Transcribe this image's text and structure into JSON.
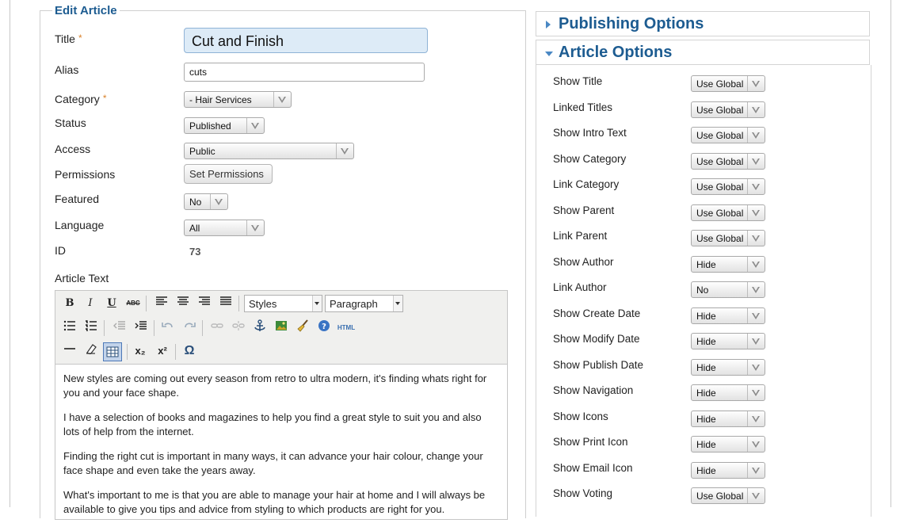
{
  "edit_article": {
    "legend": "Edit Article",
    "title_label": "Title",
    "required_mark": "*",
    "title_value": "Cut and Finish",
    "alias_label": "Alias",
    "alias_value": "cuts",
    "category_label": "Category",
    "category_value": "- Hair Services",
    "status_label": "Status",
    "status_value": "Published",
    "access_label": "Access",
    "access_value": "Public",
    "permissions_label": "Permissions",
    "permissions_button": "Set Permissions",
    "featured_label": "Featured",
    "featured_value": "No",
    "language_label": "Language",
    "language_value": "All",
    "id_label": "ID",
    "id_value": "73",
    "article_text_label": "Article Text"
  },
  "editor": {
    "toolbar": {
      "bold": "B",
      "italic": "I",
      "underline": "U",
      "strike": "ABC",
      "styles": "Styles",
      "format": "Paragraph",
      "html": "HTML",
      "subscript": "x₂",
      "superscript": "x²",
      "omega": "Ω"
    },
    "paragraphs": [
      "New styles are coming out every season from retro to ultra modern, it's finding whats right for you and your face shape.",
      "I have a selection of books and magazines to help you find a great style to suit you and also lots of help from the internet.",
      "Finding the right cut is important in many ways, it can advance your hair colour, change your face shape and even take the years away.",
      "What's important to me is that you are able to manage your hair at home and I will always be available to give you tips and advice from styling to which products are right for you."
    ]
  },
  "publishing_options": {
    "title": "Publishing Options"
  },
  "article_options": {
    "title": "Article Options",
    "options": [
      {
        "label": "Show Title",
        "value": "Use Global"
      },
      {
        "label": "Linked Titles",
        "value": "Use Global"
      },
      {
        "label": "Show Intro Text",
        "value": "Use Global"
      },
      {
        "label": "Show Category",
        "value": "Use Global"
      },
      {
        "label": "Link Category",
        "value": "Use Global"
      },
      {
        "label": "Show Parent",
        "value": "Use Global"
      },
      {
        "label": "Link Parent",
        "value": "Use Global"
      },
      {
        "label": "Show Author",
        "value": "Hide"
      },
      {
        "label": "Link Author",
        "value": "No"
      },
      {
        "label": "Show Create Date",
        "value": "Hide"
      },
      {
        "label": "Show Modify Date",
        "value": "Hide"
      },
      {
        "label": "Show Publish Date",
        "value": "Hide"
      },
      {
        "label": "Show Navigation",
        "value": "Hide"
      },
      {
        "label": "Show Icons",
        "value": "Hide"
      },
      {
        "label": "Show Print Icon",
        "value": "Hide"
      },
      {
        "label": "Show Email Icon",
        "value": "Hide"
      },
      {
        "label": "Show Voting",
        "value": "Use Global"
      }
    ]
  }
}
